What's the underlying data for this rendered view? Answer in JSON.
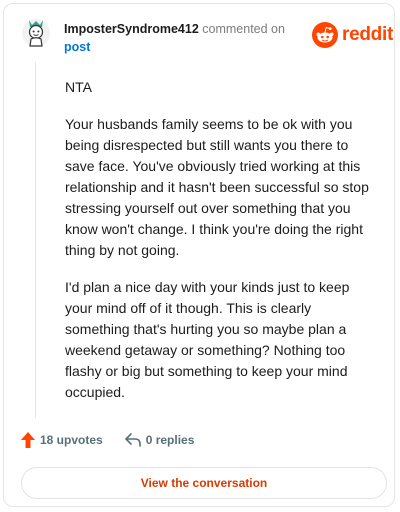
{
  "comment": {
    "username": "ImposterSyndrome412",
    "action_text": "commented on",
    "post_link": "post",
    "paragraphs": [
      "NTA",
      "Your husbands family seems to be ok with you being disrespected but still wants you there to save face. You've obviously tried working at this relationship and it hasn't been successful so stop stressing yourself out over something that you know won't change. I think you're doing the right thing by not going.",
      "I'd plan a nice day with your kinds just to keep your mind off of it though. This is clearly something that's hurting you so maybe plan a weekend getaway or something? Nothing too flashy or big but something to keep your mind occupied."
    ]
  },
  "brand": {
    "name": "reddit",
    "icon": "reddit-logo-icon",
    "color": "#ff4500"
  },
  "actions": {
    "upvotes_label": "18 upvotes",
    "upvote_icon": "upvote-arrow-icon",
    "upvote_color": "#ff4500",
    "replies_label": "0 replies",
    "reply_icon": "reply-arrow-icon"
  },
  "footer": {
    "view_label": "View the conversation"
  }
}
